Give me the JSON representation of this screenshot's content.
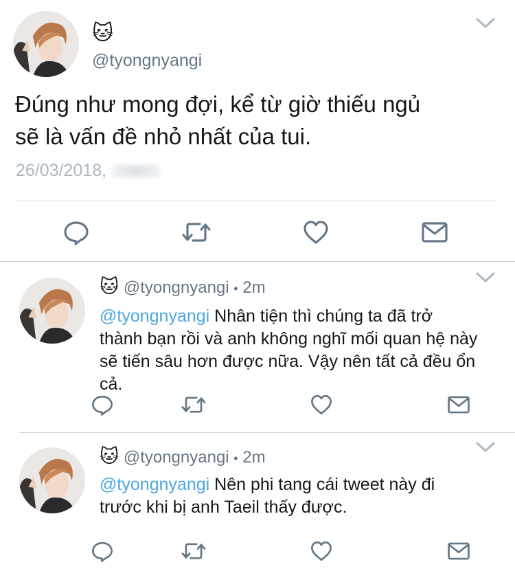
{
  "main_tweet": {
    "emoji": "🐱",
    "handle": "@tyongnyangi",
    "text_line1": "Đúng như mong đợi, kể từ giờ thiếu ngủ",
    "text_line2": "sẽ là vấn đề nhỏ nhất của tui.",
    "date": "26/03/2018,"
  },
  "replies": [
    {
      "emoji": "🐱",
      "handle": "@tyongnyangi",
      "separator": "•",
      "time": "2m",
      "mention": "@tyongnyangi",
      "line1": " Nhân tiện thì chúng ta đã trở",
      "line2": "thành bạn rồi và anh không nghĩ mối quan hệ này",
      "line3": "sẽ tiến sâu hơn được nữa. Vậy nên tất cả đều ổn",
      "line4": "cả."
    },
    {
      "emoji": "🐱",
      "handle": "@tyongnyangi",
      "separator": "•",
      "time": "2m",
      "mention": "@tyongnyangi",
      "line1": " Nên phi tang cái tweet này đi",
      "line2": "trước khi bị anh Taeil thấy được."
    }
  ],
  "icons": [
    "reply-icon",
    "retweet-icon",
    "like-icon",
    "message-icon",
    "chevron-down-icon"
  ],
  "colors": {
    "mention": "#4da6e0",
    "handle": "#657786",
    "icon": "#657786",
    "divider": "#cfd6dc"
  }
}
